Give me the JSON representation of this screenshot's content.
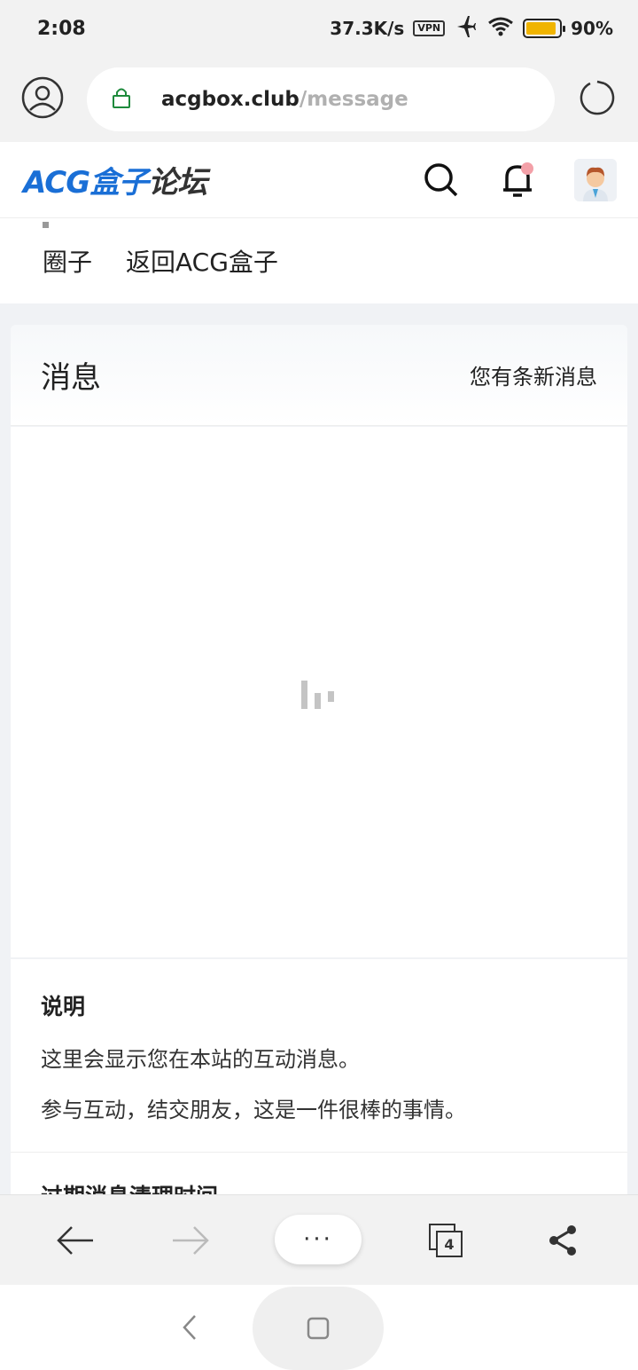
{
  "status_bar": {
    "time": "2:08",
    "net_speed": "37.3K/s",
    "vpn": "VPN",
    "battery_percent": "90%",
    "battery_level": 0.9
  },
  "browser": {
    "url_domain": "acgbox.club",
    "url_path": "/message"
  },
  "site": {
    "logo_part1": "ACG盒子",
    "logo_part2": "论坛"
  },
  "nav": {
    "items": [
      {
        "label": "圈子"
      },
      {
        "label": "返回ACG盒子"
      }
    ]
  },
  "messages": {
    "title": "消息",
    "subtitle": "您有条新消息"
  },
  "info": {
    "title": "说明",
    "line1": "这里会显示您在本站的互动消息。",
    "line2": "参与互动，结交朋友，这是一件很棒的事情。",
    "next_title": "过期消息清理时间"
  },
  "toolbar": {
    "more_label": "···",
    "tabs_count": "4"
  },
  "colors": {
    "accent": "#1a6fd6",
    "notification_dot": "#f3a0a8",
    "battery": "#f0b400"
  }
}
